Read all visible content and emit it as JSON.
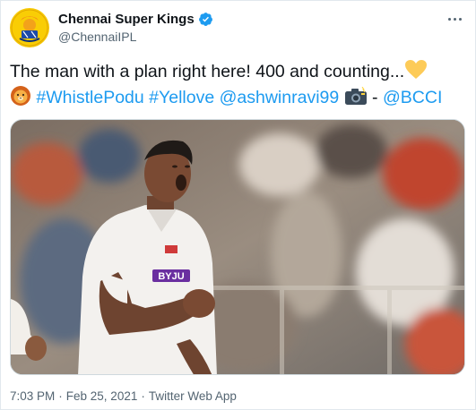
{
  "account": {
    "display_name": "Chennai Super Kings",
    "handle": "@ChennaiIPL",
    "avatar_icon": "csk-logo",
    "verified_icon": "verified-badge-icon",
    "verified_color": "#1d9bf0"
  },
  "tweet": {
    "line1_text": "The man with a plan right here! 400 and counting...",
    "line1_emoji": "yellow-heart",
    "line2_emoji_start": "lion-face",
    "hashtag1": "#WhistlePodu",
    "hashtag2": "#Yellove",
    "mention1": "@ashwinravi99",
    "line2_emoji_mid": "camera-with-flash",
    "dash": " - ",
    "mention2": "@BCCI"
  },
  "media": {
    "description_icon": "cricket-celebration-photo",
    "sponsor_text": "BYJU"
  },
  "meta": {
    "time": "7:03 PM",
    "separator": "·",
    "date": "Feb 25, 2021",
    "source": "Twitter Web App"
  },
  "colors": {
    "link": "#1d9bf0",
    "secondary_text": "#536471",
    "border": "#e1e8ed"
  }
}
